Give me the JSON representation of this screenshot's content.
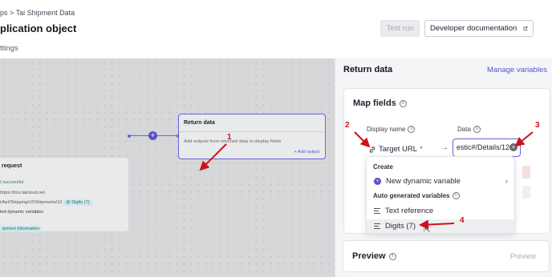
{
  "header": {
    "breadcrumb": "ps > Tai Shipment Data",
    "title": "plication object",
    "settings_tab": "ttings",
    "test_run_label": "Test run",
    "docs_label": "Developer documentation"
  },
  "canvas": {
    "request_card": {
      "title": "request",
      "status": "t successful",
      "url_line1": "https://tms.taicloud.net",
      "url_line2": "i/Api/Shipping/v2/Shipments/12",
      "digits_chip": "@ Digits (7)",
      "dynamic_label": "ted dynamic variables",
      "shipment_chip": "ipment Information"
    },
    "return_card": {
      "title": "Return data",
      "description": "Add outputs from returned data to display fields",
      "add_output": "+ Add output"
    }
  },
  "panel": {
    "title": "Return data",
    "manage_link": "Manage variables",
    "map_fields": {
      "title": "Map fields",
      "col_display": "Display name",
      "col_data": "Data",
      "target_label": "Target URL",
      "required_mark": "*",
      "data_value": "estic#/Details/12"
    },
    "preview": {
      "title": "Preview",
      "button": "Preview"
    }
  },
  "dropdown": {
    "create_header": "Create",
    "new_dynamic": "New dynamic variable",
    "auto_header": "Auto generated variables",
    "text_reference": "Text reference",
    "digits": "Digits (7)"
  },
  "annotations": {
    "n1": "1",
    "n2": "2",
    "n3": "3",
    "n4": "4"
  },
  "colors": {
    "accent": "#5a52d0",
    "annotation": "#d0101a",
    "success": "#2e8b3a"
  }
}
